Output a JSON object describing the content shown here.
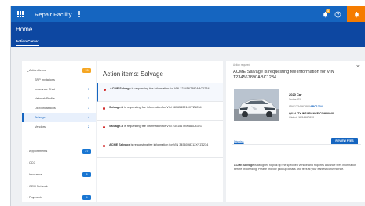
{
  "appbar": {
    "title": "Repair Facility",
    "notification_count": "1"
  },
  "subheader": {
    "page_title": "Home",
    "tab": "Action Center"
  },
  "sidebar": {
    "items": [
      {
        "label": "Action Items",
        "count": "15",
        "style": "pill-orange"
      },
      {
        "label": "SRP Invitations",
        "count": ""
      },
      {
        "label": "Insurance Chat",
        "count": "3"
      },
      {
        "label": "Network Profile",
        "count": "1"
      },
      {
        "label": "OEM Invitations",
        "count": "3"
      },
      {
        "label": "Salvage",
        "count": "4"
      },
      {
        "label": "Vendors",
        "count": "2"
      },
      {
        "label": "Appointments",
        "count": "27",
        "style": "pill-blue"
      },
      {
        "label": "CCC",
        "count": ""
      },
      {
        "label": "Insurance",
        "count": "8",
        "style": "pill-blue"
      },
      {
        "label": "OEM Network",
        "count": ""
      },
      {
        "label": "Payments",
        "count": "4",
        "style": "pill-blue"
      }
    ]
  },
  "list": {
    "title": "Action items: Salvage",
    "items": [
      {
        "bold": "ACME Salvage",
        "text": " is requesting fee information for VIN 1234567890ABC1234"
      },
      {
        "bold": "Salvage-It",
        "text": " is requesting fee information for VIN 9876543210XYZ1234"
      },
      {
        "bold": "Salvage-It",
        "text": " is requesting fee information for VIN 2341567890ABC4321"
      },
      {
        "bold": "ACME Salvage",
        "text": " is requesting fee information for VIN 3456098712XYZ1234"
      }
    ]
  },
  "detail": {
    "required": "Action required",
    "title": "ACME Salvage is requesting fee information for VIN 1234567890ABC1234",
    "car": "2020 Car",
    "car_sub": "Sedan EX",
    "vin_prefix": "VIN 1234567890",
    "vin_highlight": "ABC1234",
    "insurer": "QUALITY INSURANCE COMPANY",
    "claim": "Claim# 1234567890",
    "dismiss": "Dismiss",
    "review_button": "REVIEW FEES",
    "desc_bold": "ACME Salvage",
    "desc_text": " is assigned to pick up the specified vehicle and requires advance fees information before proceeding. Please provide pick-up details and fees at your earliest convenience."
  },
  "colors": {
    "appbar": "#1565c0",
    "subheader": "#0d47a1",
    "accent_orange": "#f57c00",
    "unread_dot": "#d32f2f"
  }
}
